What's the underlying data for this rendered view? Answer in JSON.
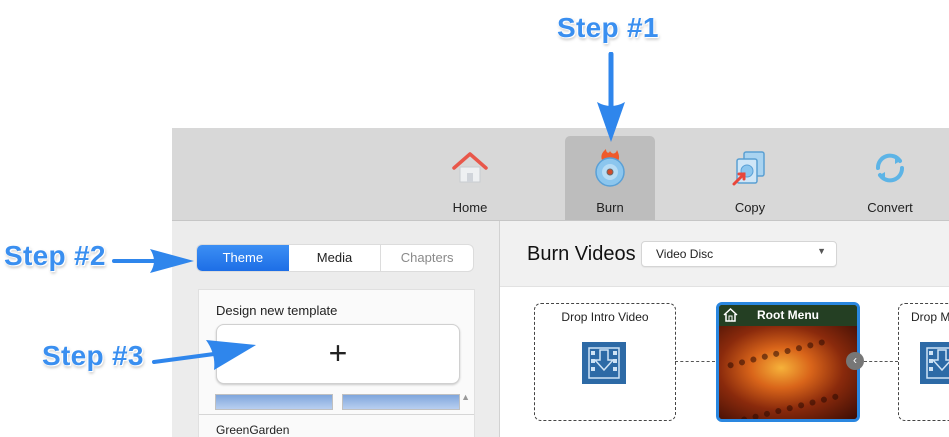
{
  "annotations": {
    "step1": "Step #1",
    "step2": "Step #2",
    "step3": "Step #3",
    "color": "#3a8ff0"
  },
  "toolbar": {
    "items": [
      {
        "label": "Home",
        "icon": "home-icon"
      },
      {
        "label": "Burn",
        "icon": "burn-disc-icon",
        "active": true
      },
      {
        "label": "Copy",
        "icon": "copy-disc-icon"
      },
      {
        "label": "Convert",
        "icon": "convert-icon"
      }
    ]
  },
  "sidebar": {
    "tabs": [
      {
        "label": "Theme",
        "selected": true
      },
      {
        "label": "Media"
      },
      {
        "label": "Chapters",
        "disabled": true
      }
    ],
    "design_title": "Design new template",
    "add_symbol": "+",
    "template_name": "GreenGarden"
  },
  "main": {
    "title": "Burn Videos",
    "disc_type": "Video Disc",
    "drop_intro": "Drop Intro Video",
    "root_menu": "Root Menu",
    "drop_next": "Drop M"
  },
  "colors": {
    "accent": "#1d6ee6",
    "menu_bar": "#243f23",
    "menu_border": "#2a87e0"
  }
}
